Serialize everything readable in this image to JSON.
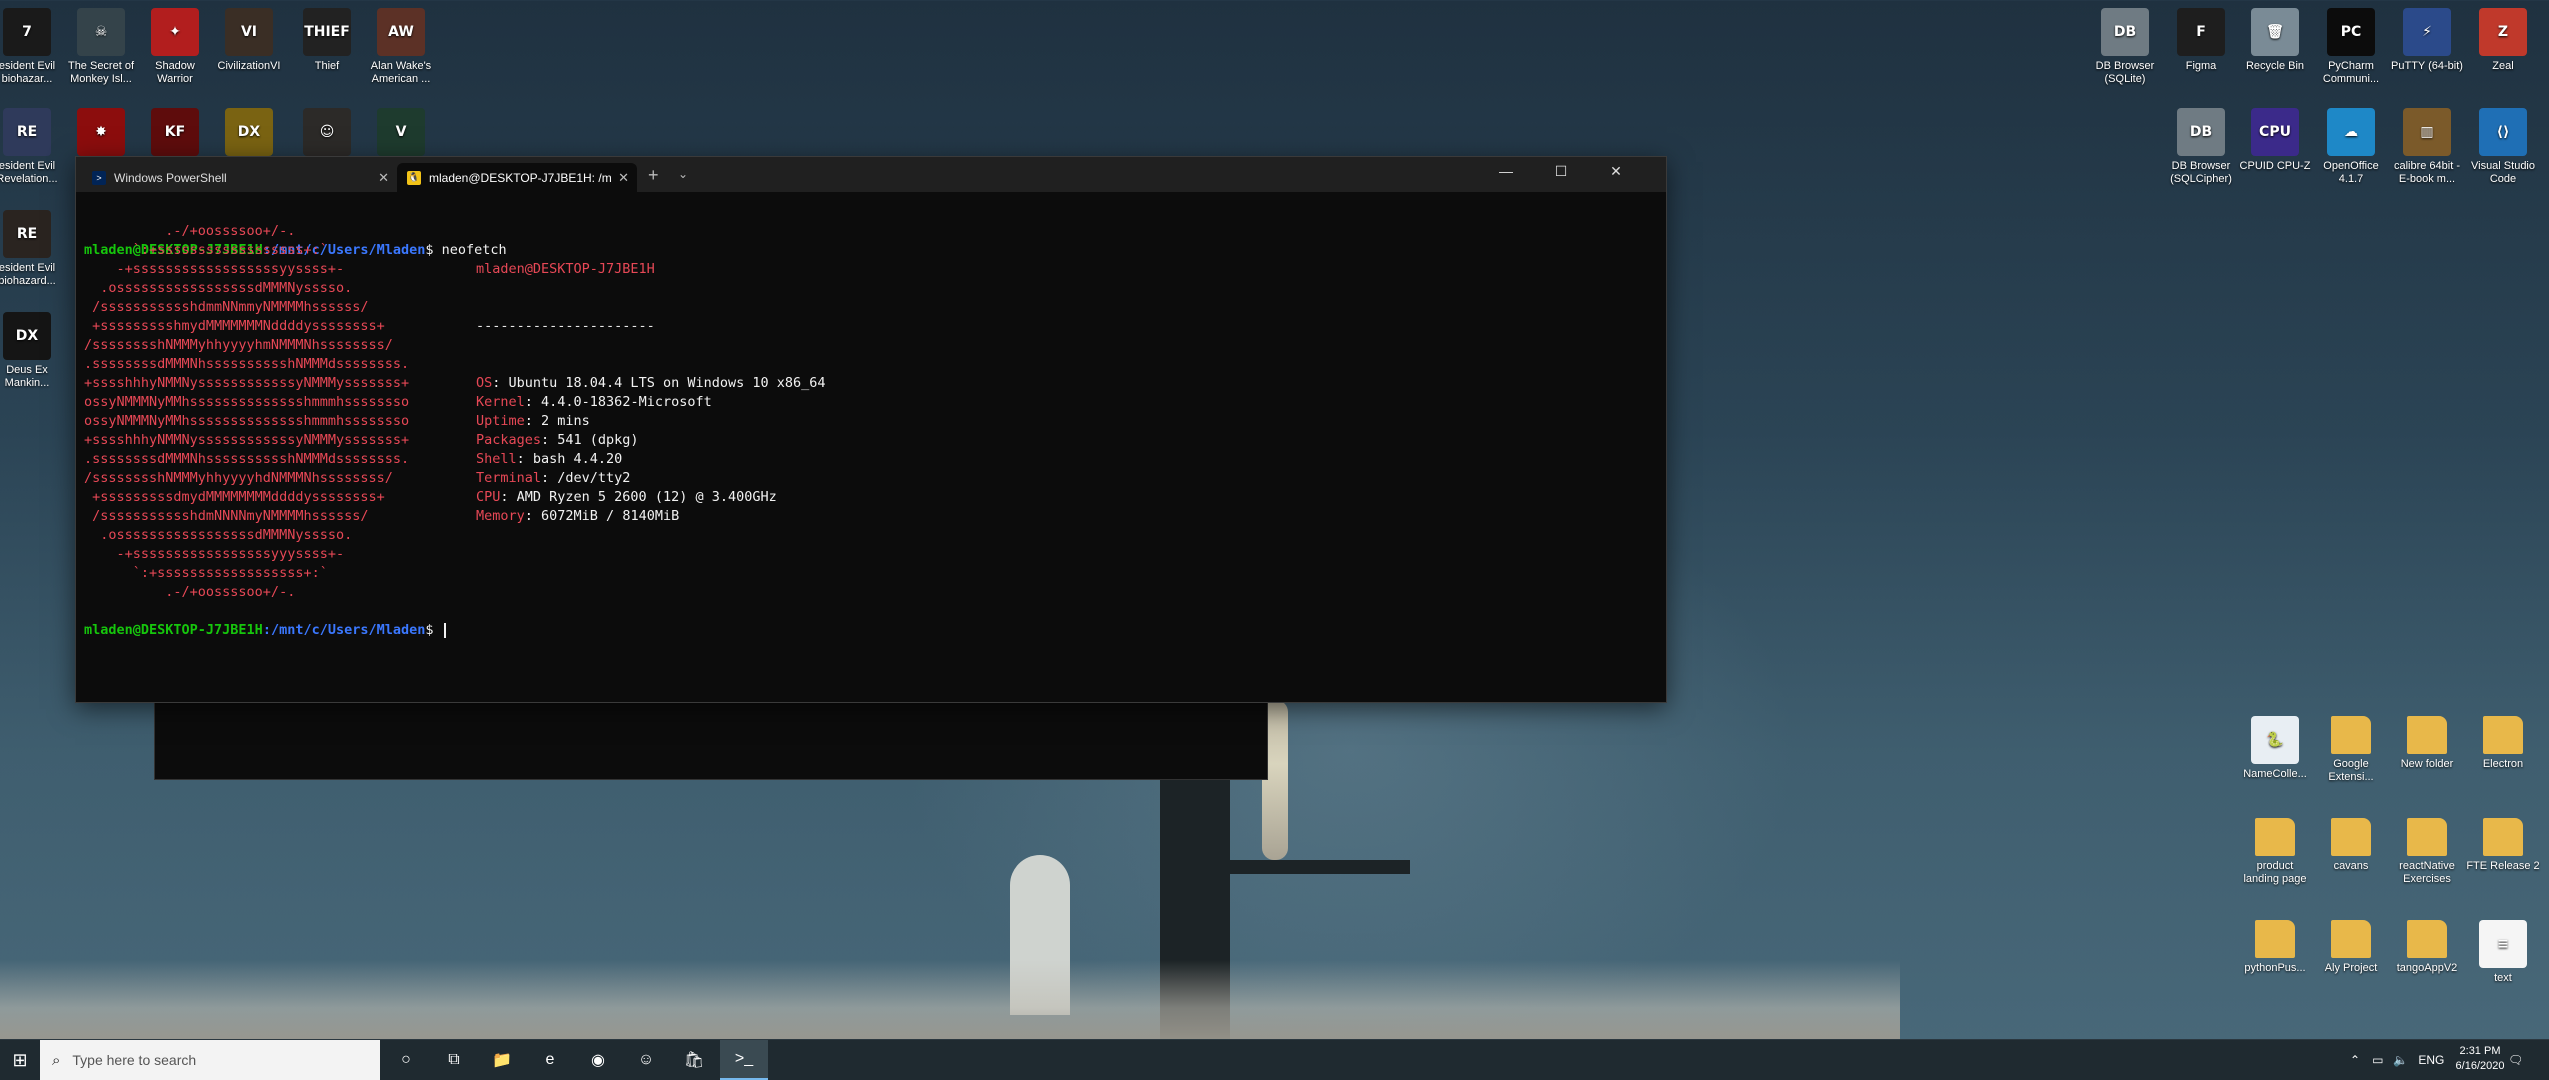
{
  "desktop": {
    "left_icons": [
      {
        "label": "esident Evil biohazar...",
        "icon": "resident-evil-icon",
        "color": "#1a1a1a",
        "glyph": "7"
      },
      {
        "label": "The Secret of Monkey Isl...",
        "icon": "monkey-island-icon",
        "color": "#34434a",
        "glyph": "☠"
      },
      {
        "label": "Shadow Warrior",
        "icon": "shadow-warrior-icon",
        "color": "#b21e1e",
        "glyph": "✦"
      },
      {
        "label": "CivilizationVI",
        "icon": "civilization-icon",
        "color": "#3a2e25",
        "glyph": "VI"
      },
      {
        "label": "Thief",
        "icon": "thief-icon",
        "color": "#222",
        "glyph": "THIEF"
      },
      {
        "label": "Alan Wake's American ...",
        "icon": "alan-wake-icon",
        "color": "#5c3126",
        "glyph": "AW"
      },
      {
        "label": "esident Evil Revelation...",
        "icon": "re-revelations-icon",
        "color": "#2f3a5b",
        "glyph": "RE"
      },
      {
        "label": "",
        "icon": "red-game-icon",
        "color": "#8c0d0d",
        "glyph": "✸"
      },
      {
        "label": "",
        "icon": "killing-floor-icon",
        "color": "#5e0c0c",
        "glyph": "KF"
      },
      {
        "label": "",
        "icon": "deus-ex-hr-icon",
        "color": "#7a6312",
        "glyph": "DX"
      },
      {
        "label": "",
        "icon": "person-game-icon",
        "color": "#2c2a28",
        "glyph": "☺"
      },
      {
        "label": "",
        "icon": "gta-v-icon",
        "color": "#1e3b2e",
        "glyph": "V"
      },
      {
        "label": "esident Evil biohazard...",
        "icon": "re-biohazard-icon",
        "color": "#2a2420",
        "glyph": "RE"
      },
      {
        "label": "Deus Ex Mankin...",
        "icon": "deus-ex-icon",
        "color": "#151515",
        "glyph": "DX"
      }
    ],
    "right_icons": [
      {
        "label": "DB Browser (SQLite)",
        "icon": "db-browser-icon",
        "color": "#6f7b83",
        "glyph": "DB"
      },
      {
        "label": "Figma",
        "icon": "figma-icon",
        "color": "#1e1e1e",
        "glyph": "F"
      },
      {
        "label": "Recycle Bin",
        "icon": "recycle-bin-icon",
        "color": "#7a8b96",
        "glyph": "🗑"
      },
      {
        "label": "PyCharm Communi...",
        "icon": "pycharm-icon",
        "color": "#0c0c0c",
        "glyph": "PC"
      },
      {
        "label": "PuTTY (64-bit)",
        "icon": "putty-icon",
        "color": "#2b4a8a",
        "glyph": "⚡"
      },
      {
        "label": "Zeal",
        "icon": "zeal-icon",
        "color": "#c0392b",
        "glyph": "Z"
      },
      {
        "label": "DB Browser (SQLCipher)",
        "icon": "db-browser-cipher-icon",
        "color": "#6f7b83",
        "glyph": "DB"
      },
      {
        "label": "CPUID CPU-Z",
        "icon": "cpuz-icon",
        "color": "#3b2a8a",
        "glyph": "CPU"
      },
      {
        "label": "OpenOffice 4.1.7",
        "icon": "openoffice-icon",
        "color": "#1e88c7",
        "glyph": "☁"
      },
      {
        "label": "calibre 64bit - E-book m...",
        "icon": "calibre-icon",
        "color": "#7b5a2a",
        "glyph": "▥"
      },
      {
        "label": "Visual Studio Code",
        "icon": "vscode-icon",
        "color": "#1f6fb5",
        "glyph": "⟨⟩"
      }
    ],
    "folder_icons": [
      {
        "label": "NameColle...",
        "icon": "python-file-icon",
        "color": "#e8eef3",
        "glyph": "🐍"
      },
      {
        "label": "Google Extensi...",
        "icon": "folder-icon",
        "color": "#e8b84a",
        "glyph": ""
      },
      {
        "label": "New folder",
        "icon": "folder-icon",
        "color": "#e8b84a",
        "glyph": ""
      },
      {
        "label": "Electron",
        "icon": "folder-icon",
        "color": "#e8b84a",
        "glyph": ""
      },
      {
        "label": "product landing page",
        "icon": "folder-icon",
        "color": "#e8b84a",
        "glyph": ""
      },
      {
        "label": "cavans",
        "icon": "folder-icon",
        "color": "#e8b84a",
        "glyph": ""
      },
      {
        "label": "reactNative Exercises",
        "icon": "folder-icon",
        "color": "#e8b84a",
        "glyph": ""
      },
      {
        "label": "FTE Release 2",
        "icon": "folder-icon",
        "color": "#e8b84a",
        "glyph": ""
      },
      {
        "label": "pythonPus...",
        "icon": "folder-icon",
        "color": "#e8b84a",
        "glyph": ""
      },
      {
        "label": "Aly Project",
        "icon": "folder-icon",
        "color": "#e8b84a",
        "glyph": ""
      },
      {
        "label": "tangoAppV2",
        "icon": "folder-icon",
        "color": "#e8b84a",
        "glyph": ""
      },
      {
        "label": "text",
        "icon": "text-file-icon",
        "color": "#f5f5f5",
        "glyph": "≡"
      }
    ]
  },
  "terminal": {
    "tabs": [
      {
        "label": "Windows PowerShell",
        "icon": "powershell-icon"
      },
      {
        "label": "mladen@DESKTOP-J7JBE1H: /m",
        "icon": "linux-icon"
      }
    ],
    "new_tab": "+",
    "user_host": "mladen@DESKTOP-J7JBE1H",
    "path": ":/mnt/c/Users/Mladen",
    "prompt_char": "$",
    "command": " neofetch",
    "logo_lines": [
      "          .-/+oossssoo+/-.",
      "      `:+ssssssssssssssssss+:`",
      "    -+ssssssssssssssssssyyssss+-",
      "  .osssssssssssssssssdMMMNysssso.",
      " /ssssssssssshdmmNNmmyNMMMMhssssss/",
      " +ssssssssshmydMMMMMMMNddddyssssssss+",
      "/sssssssshNMMMyhhyyyyhmNMMMNhssssssss/",
      ".ssssssssdMMMNhsssssssssshNMMMdssssssss.",
      "+sssshhhyNMMNyssssssssssssyNMMMysssssss+",
      "ossyNMMMNyMMhsssssssssssssshmmmhssssssso",
      "ossyNMMMNyMMhsssssssssssssshmmmhssssssso",
      "+sssshhhyNMMNyssssssssssssyNMMMysssssss+",
      ".ssssssssdMMMNhsssssssssshNMMMdssssssss.",
      "/sssssssshNMMMyhhyyyyhdNMMMNhssssssss/",
      " +sssssssssdmydMMMMMMMMddddyssssssss+",
      " /ssssssssssshdmNNNNmyNMMMMhssssss/",
      "  .osssssssssssssssssdMMMNysssso.",
      "    -+sssssssssssssssssyyyssss+-",
      "      `:+ssssssssssssssssss+:`",
      "          .-/+oossssoo+/-."
    ],
    "info": {
      "header": "mladen@DESKTOP-J7JBE1H",
      "separator": "----------------------",
      "rows": [
        {
          "key": "OS",
          "value": ": Ubuntu 18.04.4 LTS on Windows 10 x86_64"
        },
        {
          "key": "Kernel",
          "value": ": 4.4.0-18362-Microsoft"
        },
        {
          "key": "Uptime",
          "value": ": 2 mins"
        },
        {
          "key": "Packages",
          "value": ": 541 (dpkg)"
        },
        {
          "key": "Shell",
          "value": ": bash 4.4.20"
        },
        {
          "key": "Terminal",
          "value": ": /dev/tty2"
        },
        {
          "key": "CPU",
          "value": ": AMD Ryzen 5 2600 (12) @ 3.400GHz"
        },
        {
          "key": "Memory",
          "value": ": 6072MiB / 8140MiB"
        }
      ]
    }
  },
  "taskbar": {
    "search_placeholder": "Type here to search",
    "pinned": [
      {
        "name": "cortana-icon",
        "glyph": "○"
      },
      {
        "name": "task-view-icon",
        "glyph": "⧉"
      },
      {
        "name": "file-explorer-icon",
        "glyph": "📁"
      },
      {
        "name": "edge-icon",
        "glyph": "e"
      },
      {
        "name": "chrome-icon",
        "glyph": "◉"
      },
      {
        "name": "discord-icon",
        "glyph": "☺"
      },
      {
        "name": "store-icon",
        "glyph": "🛍"
      },
      {
        "name": "terminal-icon",
        "glyph": ">_"
      }
    ],
    "language": "ENG",
    "time": "2:31 PM",
    "date": "6/16/2020"
  },
  "colors": {
    "prompt_user": "#16c60c",
    "prompt_path": "#3b78ff",
    "logo_red": "#e74856",
    "terminal_bg": "#0c0c0c"
  }
}
